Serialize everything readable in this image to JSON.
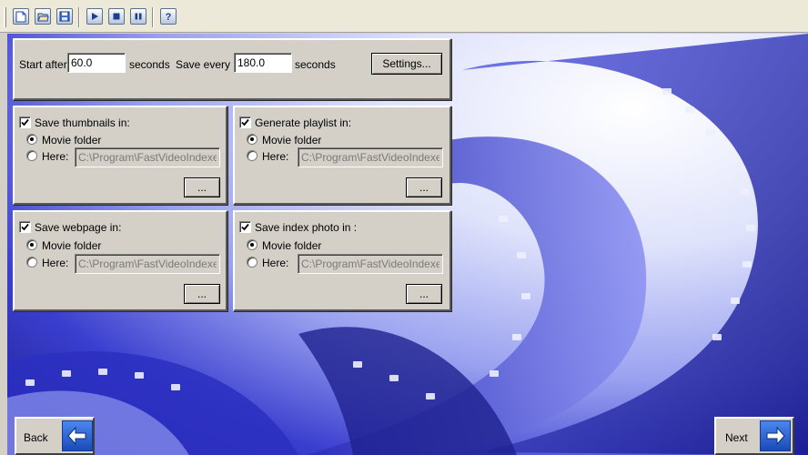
{
  "toolbar": {
    "buttons": [
      {
        "name": "new-icon"
      },
      {
        "name": "open-icon"
      },
      {
        "name": "save-icon"
      },
      {
        "name": "play-icon"
      },
      {
        "name": "stop-icon"
      },
      {
        "name": "pause-icon"
      },
      {
        "name": "help-icon"
      }
    ]
  },
  "timing": {
    "start_label": "Start after",
    "start_value": "60.0",
    "seconds_label_1": "seconds",
    "save_every_label": "Save every",
    "save_every_value": "180.0",
    "seconds_label_2": "seconds",
    "settings_label": "Settings..."
  },
  "groups": {
    "thumbnails": {
      "title": "Save thumbnails in:",
      "checked": true,
      "movie_folder": "Movie folder",
      "here": "Here:",
      "path": "C:\\Program\\FastVideoIndexer\\",
      "browse": "..."
    },
    "playlist": {
      "title": "Generate playlist in:",
      "checked": true,
      "movie_folder": "Movie folder",
      "here": "Here:",
      "path": "C:\\Program\\FastVideoIndexer\\",
      "browse": "..."
    },
    "webpage": {
      "title": "Save webpage in:",
      "checked": true,
      "movie_folder": "Movie folder",
      "here": "Here:",
      "path": "C:\\Program\\FastVideoIndexer\\",
      "browse": "..."
    },
    "index_photo": {
      "title": "Save index photo in :",
      "checked": true,
      "movie_folder": "Movie folder",
      "here": "Here:",
      "path": "C:\\Program\\FastVideoIndexer\\",
      "browse": "..."
    }
  },
  "nav": {
    "back_label": "Back",
    "next_label": "Next"
  },
  "colors": {
    "panel": "#d4d0c8",
    "accent_blue": "#1a4bb8",
    "background_film": "#3a3ecf"
  }
}
